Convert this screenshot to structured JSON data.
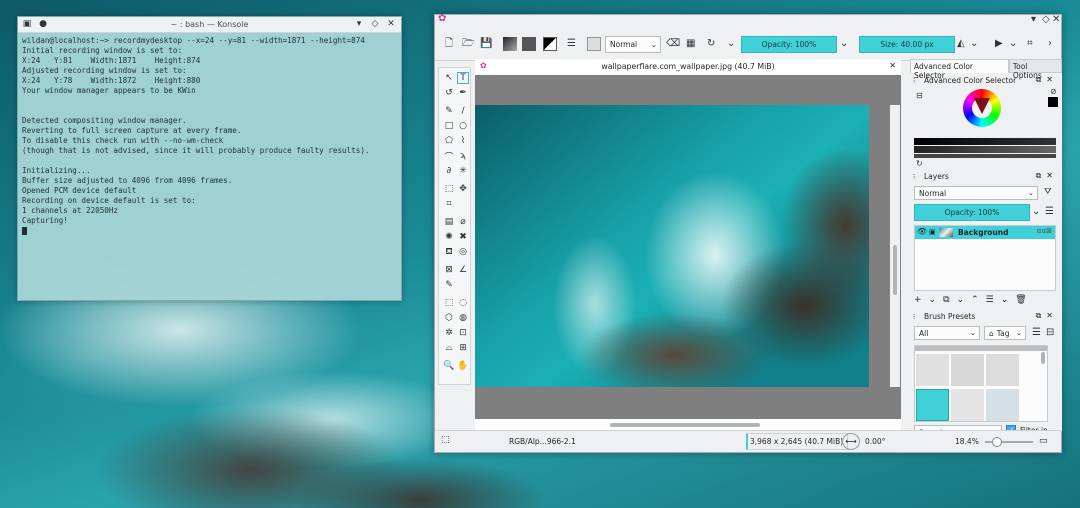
{
  "konsole": {
    "title": "~ : bash — Konsole",
    "lines": [
      "wildan@localhost:~> recordmydesktop --x=24 --y=81 --width=1871 --height=874",
      "Initial recording window is set to:",
      "X:24   Y:81    Width:1871    Height:874",
      "Adjusted recording window is set to:",
      "X:24   Y:78    Width:1872    Height:880",
      "Your window manager appears to be KWin",
      "",
      "",
      "Detected compositing window manager.",
      "Reverting to full screen capture at every frame.",
      "To disable this check run with --no-wm-check",
      "(though that is not advised, since it will probably produce faulty results).",
      "",
      "Initializing...",
      "Buffer size adjusted to 4096 from 4096 frames.",
      "Opened PCM device default",
      "Recording on device default is set to:",
      "1 channels at 22050Hz",
      "Capturing!"
    ]
  },
  "krita": {
    "toolbar": {
      "blend_mode": "Normal",
      "opacity": "Opacity: 100%",
      "size": "Size: 40.00 px"
    },
    "document_title": "wallpaperflare.com_wallpaper.jpg (40.7 MiB)",
    "dock": {
      "tabs": [
        "Advanced Color Selector",
        "Tool Options"
      ],
      "color_selector_title": "Advanced Color Selector",
      "layers_title": "Layers",
      "layers_blend": "Normal",
      "layers_opacity": "Opacity:  100%",
      "layer_name": "Background",
      "brush_presets_title": "Brush Presets",
      "brush_filter": "All",
      "brush_tag": "Tag",
      "search_placeholder": "Search",
      "filter_in_tag": "Filter in Tag"
    },
    "status": {
      "color_space": "RGB/Alp...966-2.1",
      "dimensions": "3,968 x 2,645 (40.7 MiB)",
      "rotation": "0.00°",
      "zoom": "18.4%",
      "zoom_level": 0.184
    }
  }
}
